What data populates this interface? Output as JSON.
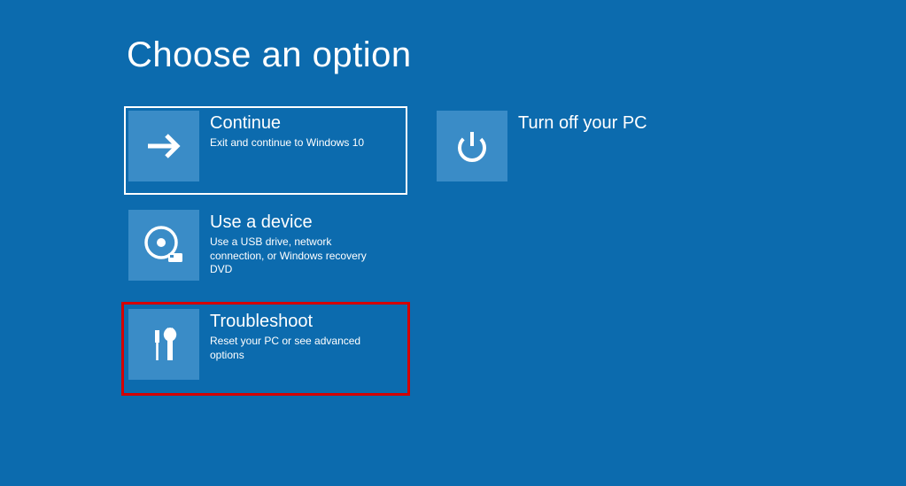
{
  "title": "Choose an option",
  "options": [
    {
      "id": "continue",
      "title": "Continue",
      "desc": "Exit and continue to Windows 10",
      "selected": true,
      "highlighted": false
    },
    {
      "id": "turnoff",
      "title": "Turn off your PC",
      "desc": "",
      "selected": false,
      "highlighted": false
    },
    {
      "id": "usedevice",
      "title": "Use a device",
      "desc": "Use a USB drive, network connection, or Windows recovery DVD",
      "selected": false,
      "highlighted": false
    },
    {
      "id": "troubleshoot",
      "title": "Troubleshoot",
      "desc": "Reset your PC or see advanced options",
      "selected": false,
      "highlighted": true
    }
  ]
}
